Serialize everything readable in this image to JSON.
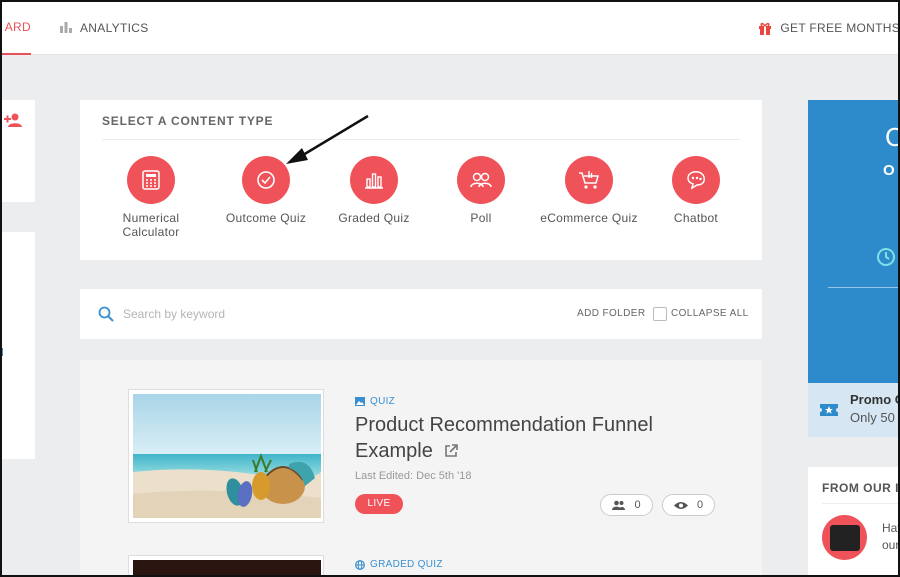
{
  "topbar": {
    "tabs": [
      {
        "label": "ARD"
      },
      {
        "label": "ANALYTICS",
        "icon": "bar-chart-icon"
      }
    ],
    "promo_label": "GET FREE MONTHS",
    "promo_icon": "gift-icon"
  },
  "content_types": {
    "title": "SELECT A CONTENT TYPE",
    "items": [
      {
        "label": "Numerical Calculator",
        "icon": "calculator-icon"
      },
      {
        "label": "Outcome Quiz",
        "icon": "check-circle-icon"
      },
      {
        "label": "Graded Quiz",
        "icon": "bar-chart-icon"
      },
      {
        "label": "Poll",
        "icon": "people-icon"
      },
      {
        "label": "eCommerce Quiz",
        "icon": "cart-icon"
      },
      {
        "label": "Chatbot",
        "icon": "chat-icon"
      }
    ]
  },
  "search": {
    "placeholder": "Search by keyword",
    "add_folder": "ADD FOLDER",
    "collapse_all": "COLLAPSE ALL"
  },
  "items": [
    {
      "type": "QUIZ",
      "title": "Product Recommendation Funnel Example",
      "last_edited": "Last Edited: Dec 5th '18",
      "status": "LIVE",
      "leads": "0",
      "views": "0"
    },
    {
      "type": "GRADED QUIZ"
    }
  ],
  "right": {
    "promo_letter_c": "C",
    "promo_letter_o": "O",
    "promo_code": "Promo C",
    "promo_only": "Only 50",
    "blog_title": "FROM OUR I",
    "blog_line1": "Hav",
    "blog_line2": "our"
  },
  "colors": {
    "accent": "#f0525a",
    "blue": "#2e8bcb",
    "link": "#3a8fd1"
  }
}
